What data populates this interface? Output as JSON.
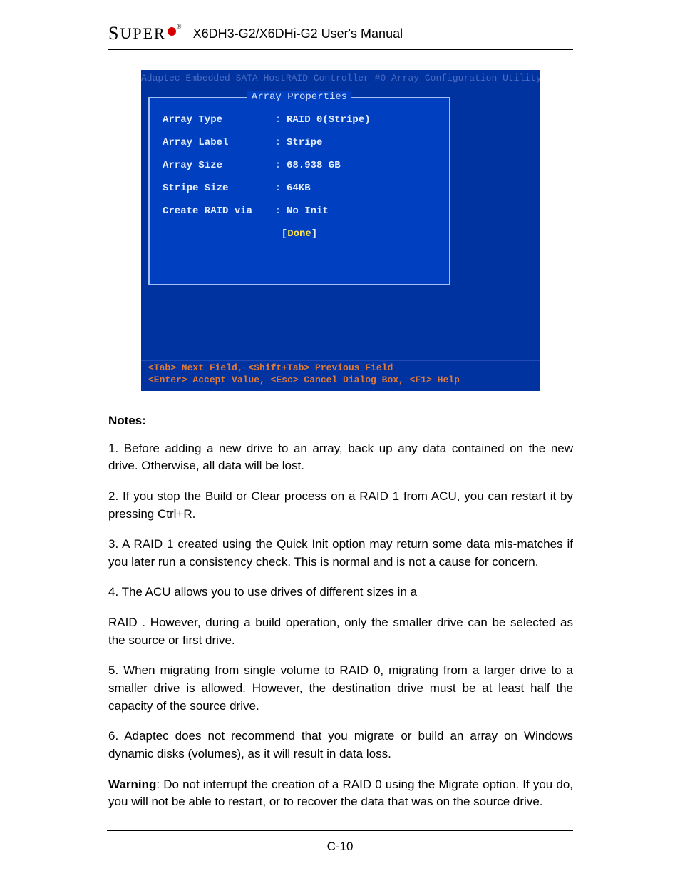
{
  "header": {
    "logo_text_cap": "S",
    "logo_text_rest": "UPER",
    "reg": "®",
    "manual_title": "X6DH3-G2/X6DHi-G2 User's Manual"
  },
  "bios": {
    "top_banner": "Adaptec Embedded SATA HostRAID Controller #0 Array Configuration Utility",
    "panel_title": "Array Properties",
    "fields": [
      {
        "label": "Array Type",
        "value": "RAID 0(Stripe)"
      },
      {
        "label": "Array Label",
        "value": "Stripe"
      },
      {
        "label": "Array Size",
        "value": "68.938 GB"
      },
      {
        "label": "Stripe Size",
        "value": "64KB"
      },
      {
        "label": "Create RAID via",
        "value": "No Init"
      }
    ],
    "done_label": "Done",
    "help_line1": "<Tab> Next Field, <Shift+Tab> Previous Field",
    "help_line2": "<Enter> Accept Value, <Esc> Cancel Dialog Box, <F1> Help"
  },
  "notes": {
    "title": "Notes:",
    "items": [
      "1. Before adding a new drive to an array, back up any data contained on the new drive. Otherwise, all data will be lost.",
      "2. If you stop the Build or Clear process on a RAID 1 from ACU, you can restart it by pressing Ctrl+R.",
      "3. A RAID 1 created using the Quick Init option may return some data mis-matches if you later run a consistency check. This is normal and is not a cause for concern.",
      "4. The ACU allows you to use drives of different sizes in a",
      "RAID . However, during a build operation, only the smaller drive can be selected as the source or first drive.",
      "5. When migrating from single volume to RAID 0, migrating from a larger drive to a smaller drive is allowed. However, the destination drive must be at least half the capacity of the source drive.",
      "6. Adaptec does not recommend that you migrate or build an array on Windows dynamic disks (volumes), as it will result in data loss."
    ],
    "warning_label": "Warning",
    "warning_text": ": Do not interrupt the creation of a RAID 0 using the Migrate option. If you do, you will not be able to restart, or to recover the data that was on the source drive."
  },
  "page_number": "C-10"
}
